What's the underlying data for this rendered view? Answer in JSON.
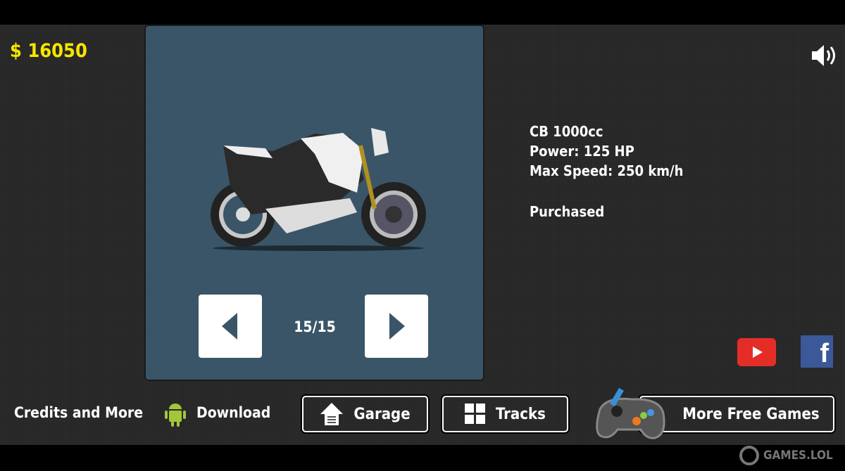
{
  "hud": {
    "money": "$ 16050",
    "sound_icon": "speaker-icon"
  },
  "garage": {
    "counter": "15/15",
    "prev_icon": "arrow-left-icon",
    "next_icon": "arrow-right-icon"
  },
  "bike": {
    "name": "CB 1000cc",
    "power": "Power: 125 HP",
    "max_speed": "Max Speed: 250 km/h",
    "status": "Purchased"
  },
  "footer": {
    "credits": "Credits and More",
    "download": "Download",
    "garage": "Garage",
    "tracks": "Tracks",
    "more_games": "More Free Games"
  },
  "social": {
    "youtube_color": "#e52d27",
    "facebook_color": "#3b5998"
  },
  "watermark": "GAMES.LOL"
}
